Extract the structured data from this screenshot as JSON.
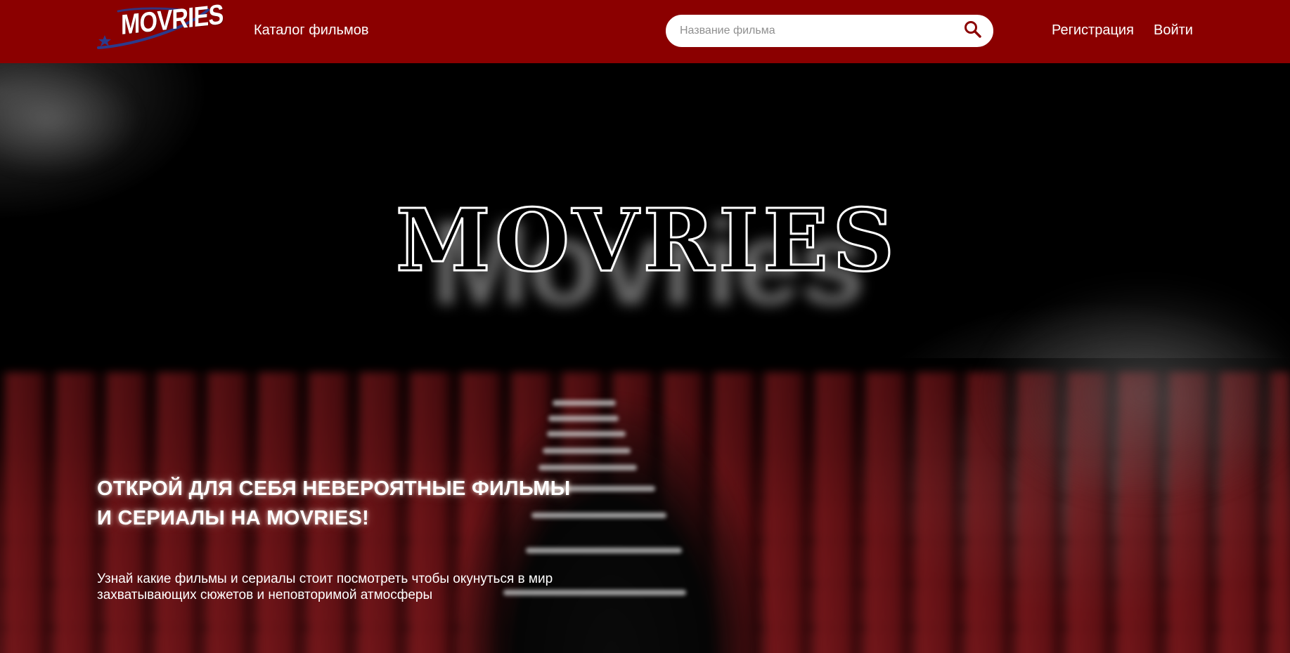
{
  "header": {
    "logo_text": "MOVRIES",
    "nav": {
      "catalog_label": "Каталог фильмов",
      "register_label": "Регистрация",
      "login_label": "Войти"
    },
    "search": {
      "placeholder": "Название фильма",
      "value": "",
      "icon": "search-icon"
    }
  },
  "hero": {
    "title": "MOVRIES",
    "background_sign_text": "Movries",
    "headline": "Открой для себя невероятные фильмы и сериалы на MOVRIES!",
    "description": "Узнай какие фильмы и сериалы стоит посмотреть чтобы окунуться в мир захватывающих сюжетов и неповторимой атмосферы"
  },
  "colors": {
    "header_bg": "#8b0000",
    "text": "#ffffff",
    "logo_accent": "#2b3a8c"
  }
}
